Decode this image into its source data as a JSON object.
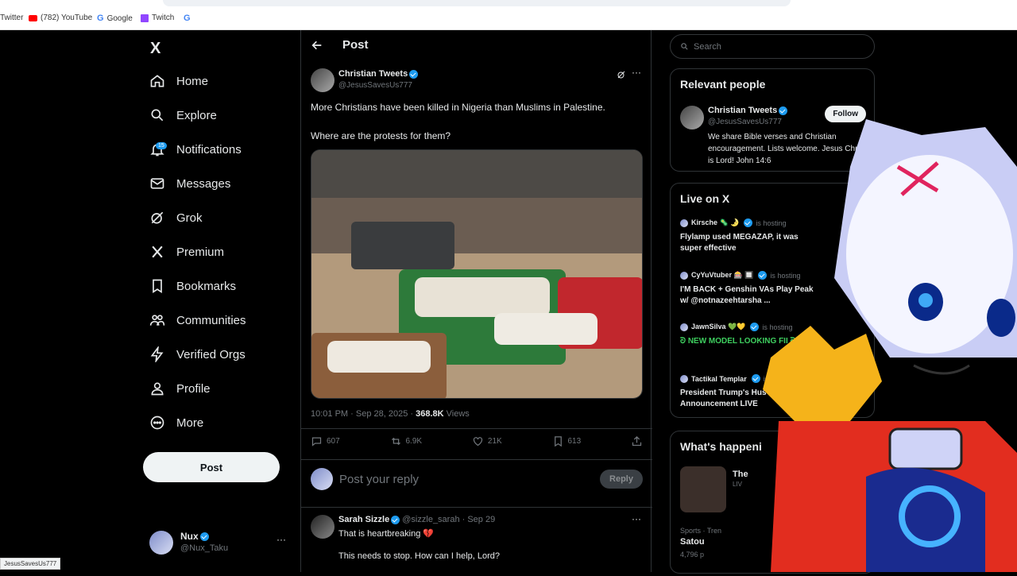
{
  "browser": {
    "bookmarks": [
      {
        "label": "Twitter"
      },
      {
        "label": "(782) YouTube"
      },
      {
        "label": "Google"
      },
      {
        "label": "Twitch"
      },
      {
        "label": "G"
      }
    ],
    "status_url": "JesusSavesUs777"
  },
  "nav": {
    "logo": "X",
    "items": [
      {
        "label": "Home",
        "icon": "home-icon"
      },
      {
        "label": "Explore",
        "icon": "search-icon"
      },
      {
        "label": "Notifications",
        "icon": "bell-icon",
        "badge": "15"
      },
      {
        "label": "Messages",
        "icon": "envelope-icon"
      },
      {
        "label": "Grok",
        "icon": "grok-icon"
      },
      {
        "label": "Premium",
        "icon": "x-icon"
      },
      {
        "label": "Bookmarks",
        "icon": "bookmark-icon"
      },
      {
        "label": "Communities",
        "icon": "people-icon"
      },
      {
        "label": "Verified Orgs",
        "icon": "lightning-icon"
      },
      {
        "label": "Profile",
        "icon": "person-icon"
      },
      {
        "label": "More",
        "icon": "more-circle-icon"
      }
    ],
    "post_button": "Post",
    "account": {
      "name": "Nux",
      "handle": "@Nux_Taku"
    }
  },
  "post": {
    "header": "Post",
    "author": "Christian Tweets",
    "handle": "@JesusSavesUs777",
    "text_line1": "More Christians have been killed in Nigeria than Muslims in Palestine.",
    "text_line2": "Where are the protests for them?",
    "time": "10:01 PM · Sep 28, 2025 · ",
    "views": "368.8K",
    "views_label": " Views",
    "replies": "607",
    "reposts": "6.9K",
    "likes": "21K",
    "bookmarks": "613",
    "reply_placeholder": "Post your reply",
    "reply_button": "Reply"
  },
  "reply": {
    "author": "Sarah Sizzle",
    "handle": "@sizzle_sarah · Sep 29",
    "text1": "That is heartbreaking 💔",
    "text2": "This needs to stop. How can I help, Lord?"
  },
  "sidebar": {
    "search_placeholder": "Search",
    "relevant_title": "Relevant people",
    "person": {
      "name": "Christian Tweets",
      "handle": "@JesusSavesUs777",
      "follow": "Follow",
      "bio": "We share Bible verses and Christian encouragement. Lists welcome. Jesus Christ is Lord! John 14:6"
    },
    "live_title": "Live on X",
    "live": [
      {
        "host": "Kirsche 🦠 🌛",
        "status": "is hosting",
        "title": "Flylamp used MEGAZAP, it was super effective"
      },
      {
        "host": "CyYuVtuber 🎰 🔲",
        "status": "is hosting",
        "title": "I'M BACK + Genshin VAs Play Peak w/ @notnazeehtarsha ..."
      },
      {
        "host": "JawnSilva 💚💛",
        "status": "is hosting",
        "title": "ᘐ NEW MODEL LOOKING FII ᘐ"
      },
      {
        "host": "Tactikal Templar",
        "status": "is",
        "title": "President Trump's Hus Announcement LIVE"
      }
    ],
    "happening_title": "What's happeni",
    "trend": {
      "category": "Sports · Tren",
      "title": "Satou",
      "count": "4,796 p",
      "tag": "The",
      "sub": "LIV"
    }
  }
}
